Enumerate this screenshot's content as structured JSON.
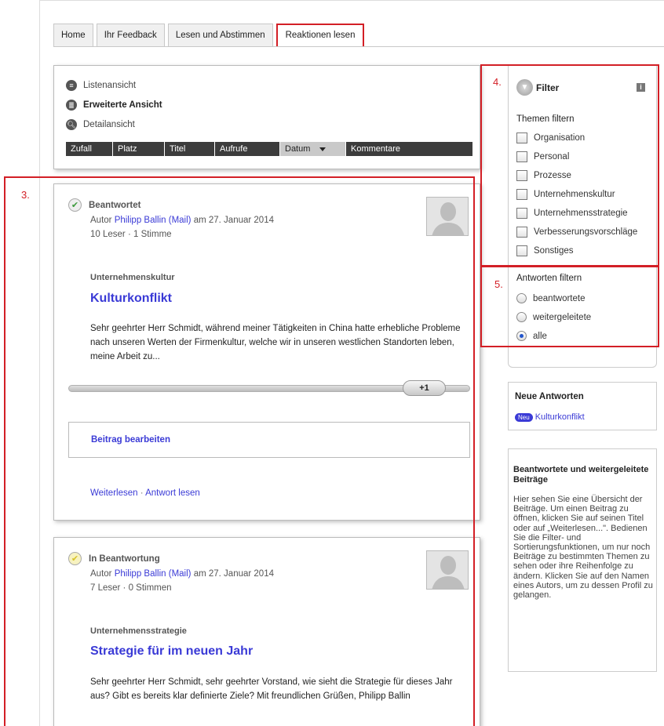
{
  "tabs": [
    "Home",
    "Ihr Feedback",
    "Lesen und Abstimmen",
    "Reaktionen lesen"
  ],
  "view_options": [
    {
      "label": "Listenansicht",
      "icon": "list-icon"
    },
    {
      "label": "Erweiterte Ansicht",
      "icon": "extended-view-icon"
    },
    {
      "label": "Detailansicht",
      "icon": "magnifier-icon"
    }
  ],
  "sort_bar": [
    "Zufall",
    "Platz",
    "Titel",
    "Aufrufe",
    "Datum",
    "Kommentare"
  ],
  "posts": [
    {
      "status": "Beantwortet",
      "status_icon": "check-circle-icon",
      "author_prefix": "Autor ",
      "author": "Philipp Ballin",
      "mail": "(Mail)",
      "date": " am 27. Januar 2014",
      "stats": "10 Leser · 1 Stimme",
      "category": "Unternehmenskultur",
      "title": "Kulturkonflikt",
      "text": "Sehr geehrter Herr Schmidt, während meiner Tätigkeiten in China hatte erhebliche Probleme nach unseren Werten der Firmenkultur, welche wir in unseren westlichen Standorten leben, meine Arbeit zu...",
      "vote_label": "+1",
      "edit_label": "Beitrag bearbeiten",
      "readmore": "Weiterlesen",
      "answer": "Antwort lesen"
    },
    {
      "status": "In Beantwortung",
      "status_icon": "pending-circle-icon",
      "author_prefix": "Autor ",
      "author": "Philipp Ballin",
      "mail": "(Mail)",
      "date": " am 27. Januar 2014",
      "stats": "7 Leser · 0 Stimmen",
      "category": "Unternehmensstrategie",
      "title": "Strategie für im neuen Jahr",
      "text": "Sehr geehrter Herr Schmidt, sehr geehrter Vorstand, wie sieht die Strategie für dieses Jahr aus? Gibt es bereits klar definierte Ziele? Mit freundlichen Grüßen, Philipp Ballin"
    }
  ],
  "filter": {
    "title": "Filter",
    "info": "i",
    "topics_title": "Themen filtern",
    "topics": [
      "Organisation",
      "Personal",
      "Prozesse",
      "Unternehmenskultur",
      "Unternehmensstrategie",
      "Verbesserungsvorschläge",
      "Sonstiges"
    ],
    "answers_title": "Antworten filtern",
    "answers": [
      "beantwortete",
      "weitergeleitete",
      "alle"
    ],
    "answers_selected": "alle"
  },
  "news": {
    "title": "Neue Antworten",
    "badge": "Neu",
    "item": "Kulturkonflikt"
  },
  "help": {
    "title": "Beantwortete und weitergeleitete Beiträge",
    "text": "Hier sehen Sie eine Übersicht der Beiträge. Um einen Beitrag zu öffnen, klicken Sie auf seinen Titel oder auf „Weiterlesen...\". Bedienen Sie die Filter- und Sortierungsfunktionen, um nur noch Beiträge zu bestimmten Themen zu sehen oder ihre Reihenfolge zu ändern. Klicken Sie auf den Namen eines Autors, um zu dessen Profil zu gelangen."
  },
  "annotations": [
    "3.",
    "4.",
    "5."
  ],
  "colors": {
    "link": "#3a3ad6",
    "annotation": "#d31f26",
    "sortbar": "#3c3c3c"
  }
}
